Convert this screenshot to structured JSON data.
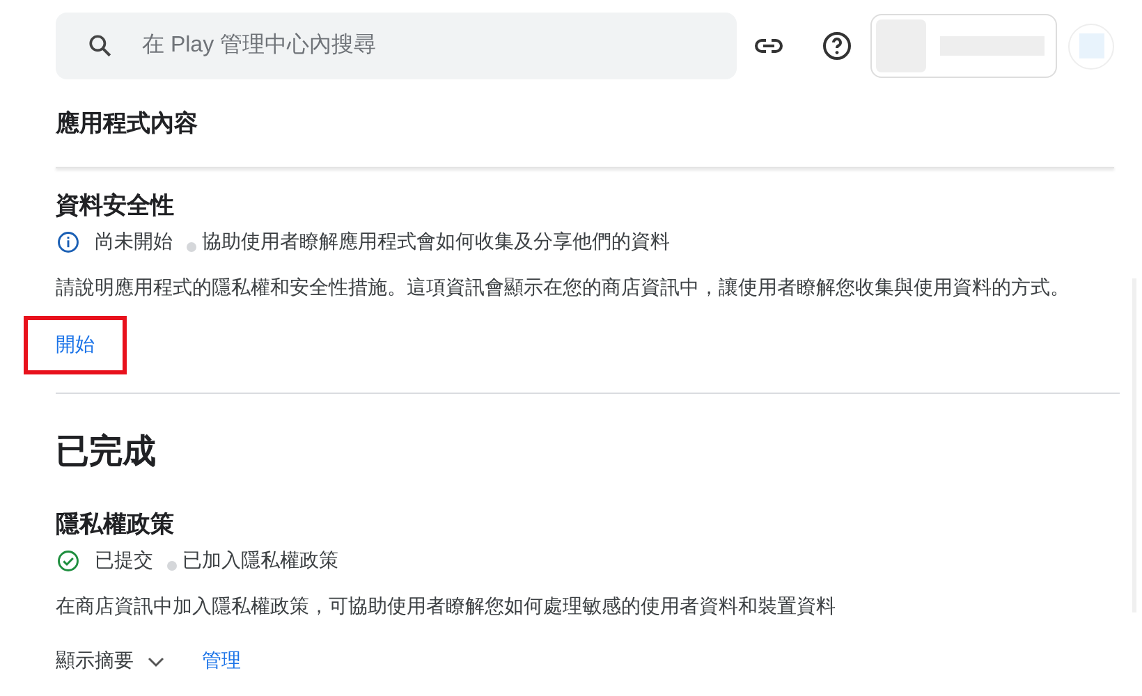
{
  "search": {
    "placeholder": "在 Play 管理中心內搜尋"
  },
  "page_title": "應用程式內容",
  "pending_task": {
    "title": "資料安全性",
    "status": {
      "kind": "info",
      "label": "尚未開始",
      "detail": "協助使用者瞭解應用程式會如何收集及分享他們的資料"
    },
    "description": "請說明應用程式的隱私權和安全性措施。這項資訊會顯示在您的商店資訊中，讓使用者瞭解您收集與使用資料的方式。",
    "action": {
      "label": "開始",
      "highlighted": true
    }
  },
  "completed_section": {
    "heading": "已完成",
    "tasks": [
      {
        "title": "隱私權政策",
        "status": {
          "kind": "done",
          "label": "已提交",
          "detail": "已加入隱私權政策"
        },
        "description": "在商店資訊中加入隱私權政策，可協助使用者瞭解您如何處理敏感的使用者資料和裝置資料",
        "summary_toggle": {
          "label": "顯示摘要",
          "expanded": false
        },
        "action": {
          "label": "管理"
        }
      }
    ]
  }
}
